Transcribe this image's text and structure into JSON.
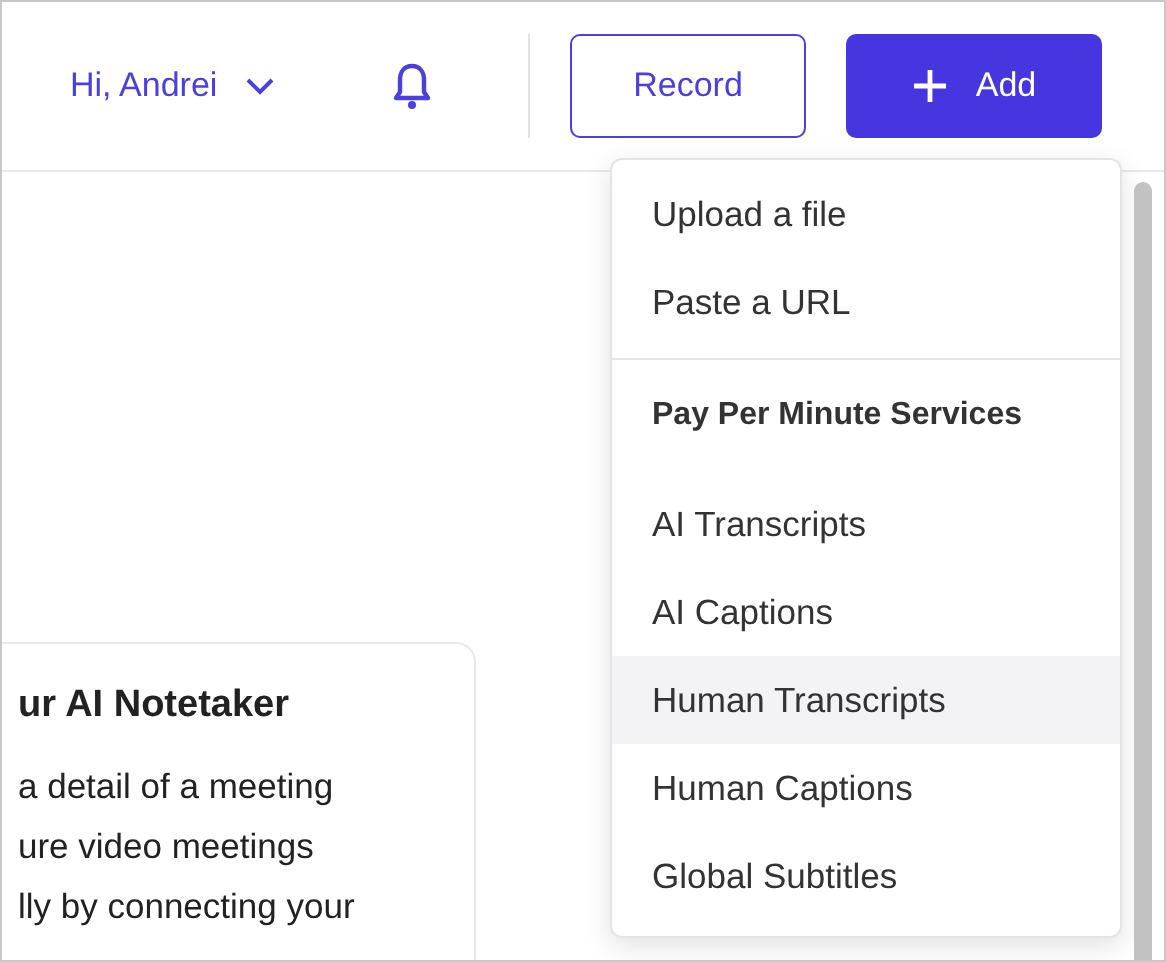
{
  "header": {
    "greeting": "Hi, Andrei",
    "record_button": "Record",
    "add_button": "Add"
  },
  "card": {
    "title": "ur AI Notetaker",
    "lines": [
      "a detail of a meeting",
      "ure video meetings",
      "lly by connecting your"
    ]
  },
  "add_menu": [
    {
      "kind": "item",
      "label": "Upload a file",
      "selected": false
    },
    {
      "kind": "item",
      "label": "Paste a URL",
      "selected": false
    },
    {
      "kind": "heading",
      "label": "Pay Per Minute Services"
    },
    {
      "kind": "item",
      "label": "AI Transcripts",
      "selected": false
    },
    {
      "kind": "item",
      "label": "AI Captions",
      "selected": false
    },
    {
      "kind": "item",
      "label": "Human Transcripts",
      "selected": true
    },
    {
      "kind": "item",
      "label": "Human Captions",
      "selected": false
    },
    {
      "kind": "item",
      "label": "Global Subtitles",
      "selected": false
    }
  ]
}
